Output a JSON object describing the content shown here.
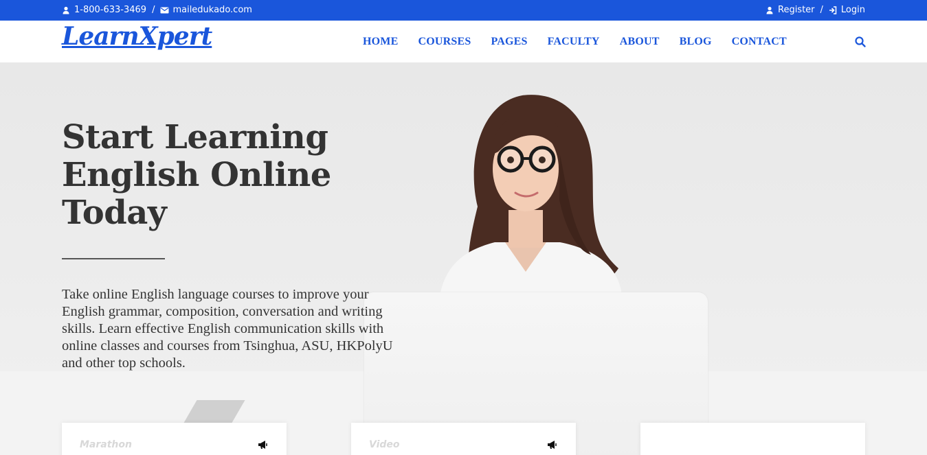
{
  "topbar": {
    "phone": "1-800-633-3469",
    "separator": "/",
    "email": "mailedukado.com",
    "register_label": "Register",
    "login_label": "Login"
  },
  "header": {
    "logo": "LearnXpert",
    "nav": [
      {
        "label": "HOME"
      },
      {
        "label": "COURSES"
      },
      {
        "label": "PAGES"
      },
      {
        "label": "FACULTY"
      },
      {
        "label": "ABOUT"
      },
      {
        "label": "BLOG"
      },
      {
        "label": "CONTACT"
      }
    ],
    "search_icon": "search-icon"
  },
  "hero": {
    "title_lines": [
      "Start Learning",
      "English Online",
      "Today"
    ],
    "description": "Take online English language courses to improve your English grammar, composition, conversation and writing skills. Learn effective English communication skills with online classes and courses from Tsinghua, ASU, HKPolyU and other top schools."
  },
  "cards": [
    {
      "label": "Marathon",
      "icon": "megaphone-icon"
    },
    {
      "label": "Video",
      "icon": "megaphone-icon"
    },
    {
      "label": "",
      "icon": ""
    }
  ],
  "colors": {
    "brand": "#1a56db",
    "text": "#333333"
  }
}
